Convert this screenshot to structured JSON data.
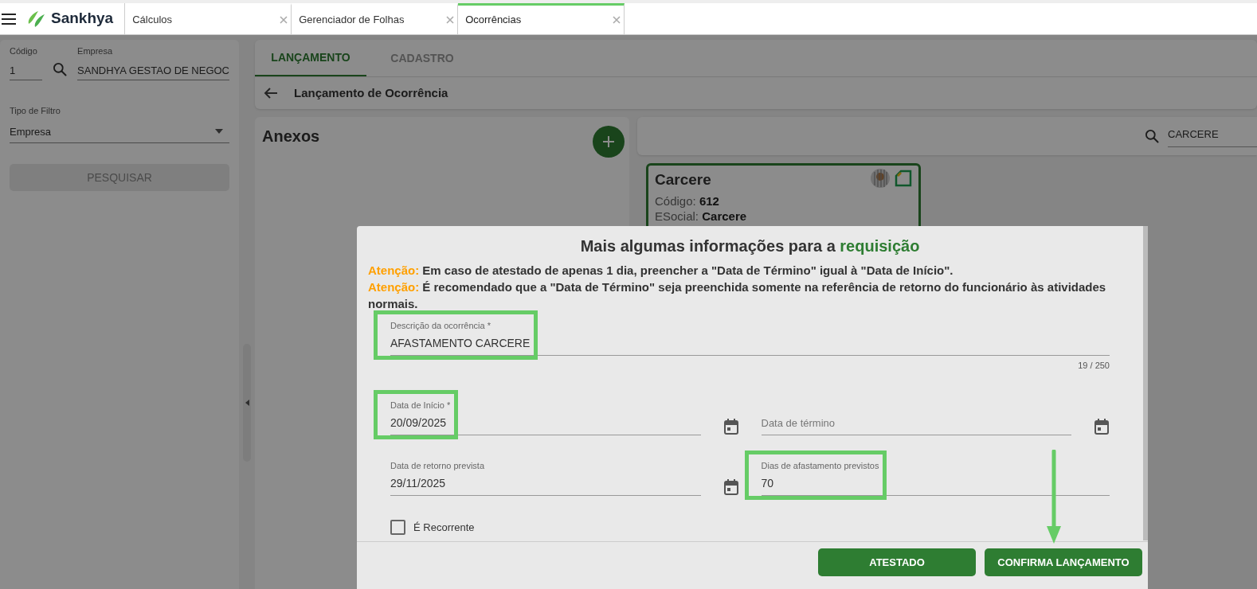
{
  "header": {
    "brand": "Sankhya",
    "tabs": [
      {
        "label": "Cálculos",
        "selected": false
      },
      {
        "label": "Gerenciador de Folhas",
        "selected": false
      },
      {
        "label": "Ocorrências",
        "selected": true
      }
    ]
  },
  "filter_panel": {
    "fields": [
      {
        "label": "Código",
        "value": "1"
      },
      {
        "label": "Empresa",
        "value": "SANDHYA GESTAO DE NEGOC"
      }
    ],
    "filter_type": {
      "label": "Tipo de Filtro",
      "value": "Empresa"
    },
    "search_button": {
      "label": "PESQUISAR",
      "disabled": true
    }
  },
  "main_tabs": [
    {
      "label": "LANÇAMENTO",
      "selected": true
    },
    {
      "label": "CADASTRO",
      "selected": false
    }
  ],
  "page_title": "Lançamento de Ocorrência",
  "attachments": {
    "title": "Anexos"
  },
  "search": {
    "value": "CARCERE"
  },
  "occurrence_card": {
    "title": "Carcere",
    "lines": [
      {
        "label": "Código:",
        "value": "612"
      },
      {
        "label": "ESocial:",
        "value": "Carcere"
      }
    ]
  },
  "dialog": {
    "title": "Mais algumas informações para a",
    "title_highlight": "requisição",
    "notices": [
      {
        "label": "Atenção:",
        "text": "Em caso de atestado de apenas 1 dia, preencher a \"Data de Término\" igual à \"Data de Início\"."
      },
      {
        "label": "Atenção:",
        "text": "É recomendado que a \"Data de Término\" seja preenchida somente na referência de retorno do funcionário às atividades normais."
      }
    ],
    "rows": [
      [
        {
          "kind": "text",
          "label": "Descrição da ocorrência *",
          "value": "AFASTAMENTO CARCERE",
          "counter": "19 / 250",
          "highlighted": true
        }
      ],
      [
        {
          "kind": "date",
          "label": "Data de Início *",
          "value": "20/09/2025",
          "highlighted": true
        },
        {
          "kind": "date",
          "placeholder": "Data de término",
          "highlighted": false
        }
      ],
      [
        {
          "kind": "date",
          "label": "Data de retorno prevista",
          "value": "29/11/2025",
          "highlighted": false
        },
        {
          "kind": "number",
          "label": "Dias de afastamento previstos",
          "value": "70",
          "highlighted": true
        }
      ]
    ],
    "checkbox": {
      "label": "É Recorrente",
      "checked": false
    },
    "buttons": [
      {
        "label": "ATESTADO",
        "marked": false
      },
      {
        "label": "CONFIRMA LANÇAMENTO",
        "marked": true
      }
    ]
  }
}
